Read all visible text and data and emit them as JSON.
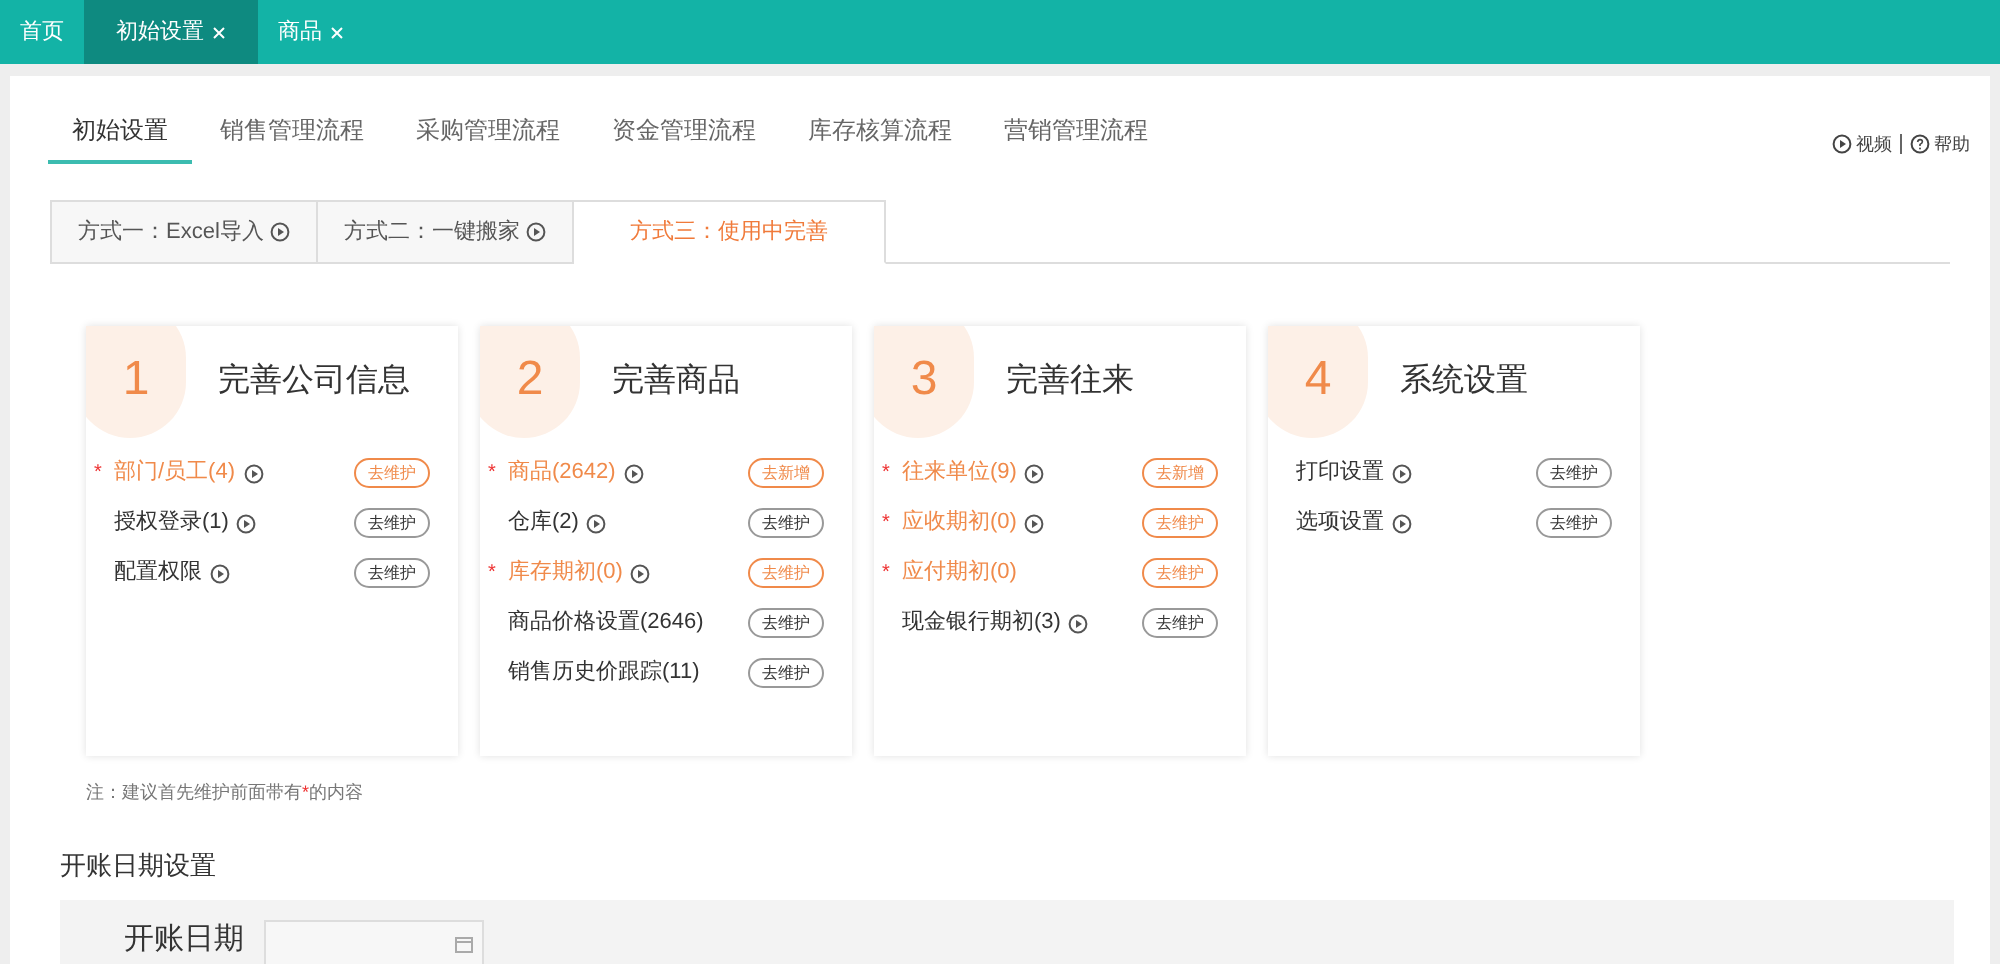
{
  "top_tabs": [
    {
      "label": "首页",
      "closable": false,
      "selected": false
    },
    {
      "label": "初始设置",
      "closable": true,
      "selected": true
    },
    {
      "label": "商品",
      "closable": true,
      "selected": false
    }
  ],
  "flow_tabs": [
    {
      "label": "初始设置",
      "selected": true
    },
    {
      "label": "销售管理流程",
      "selected": false
    },
    {
      "label": "采购管理流程",
      "selected": false
    },
    {
      "label": "资金管理流程",
      "selected": false
    },
    {
      "label": "库存核算流程",
      "selected": false
    },
    {
      "label": "营销管理流程",
      "selected": false
    }
  ],
  "help_links": [
    {
      "label": "视频",
      "kind": "video"
    },
    {
      "label": "帮助",
      "kind": "help"
    }
  ],
  "method_tabs": [
    {
      "label": "方式一：Excel导入",
      "video": true,
      "selected": false
    },
    {
      "label": "方式二：一键搬家",
      "video": true,
      "selected": false
    },
    {
      "label": "方式三：使用中完善",
      "video": false,
      "selected": true
    }
  ],
  "cards": [
    {
      "number": "1",
      "title": "完善公司信息",
      "items": [
        {
          "label": "部门/员工(4)",
          "required": true,
          "video": true,
          "action": "去维护"
        },
        {
          "label": "授权登录(1)",
          "required": false,
          "video": true,
          "action": "去维护"
        },
        {
          "label": "配置权限",
          "required": false,
          "video": true,
          "action": "去维护"
        }
      ]
    },
    {
      "number": "2",
      "title": "完善商品",
      "items": [
        {
          "label": "商品(2642)",
          "required": true,
          "video": true,
          "action": "去新增"
        },
        {
          "label": "仓库(2)",
          "required": false,
          "video": true,
          "action": "去维护"
        },
        {
          "label": "库存期初(0)",
          "required": true,
          "video": true,
          "action": "去维护"
        },
        {
          "label": "商品价格设置(2646)",
          "required": false,
          "video": false,
          "action": "去维护"
        },
        {
          "label": "销售历史价跟踪(11)",
          "required": false,
          "video": false,
          "action": "去维护"
        }
      ]
    },
    {
      "number": "3",
      "title": "完善往来",
      "items": [
        {
          "label": "往来单位(9)",
          "required": true,
          "video": true,
          "action": "去新增"
        },
        {
          "label": "应收期初(0)",
          "required": true,
          "video": true,
          "action": "去维护"
        },
        {
          "label": "应付期初(0)",
          "required": true,
          "video": false,
          "action": "去维护"
        },
        {
          "label": "现金银行期初(3)",
          "required": false,
          "video": true,
          "action": "去维护"
        }
      ]
    },
    {
      "number": "4",
      "title": "系统设置",
      "items": [
        {
          "label": "打印设置",
          "required": false,
          "video": true,
          "action": "去维护"
        },
        {
          "label": "选项设置",
          "required": false,
          "video": true,
          "action": "去维护"
        }
      ]
    }
  ],
  "note": {
    "before": "注：建议首先维护前面带有",
    "mark": "*",
    "after": "的内容"
  },
  "opening_date": {
    "title": "开账日期设置",
    "label": "开账日期"
  }
}
